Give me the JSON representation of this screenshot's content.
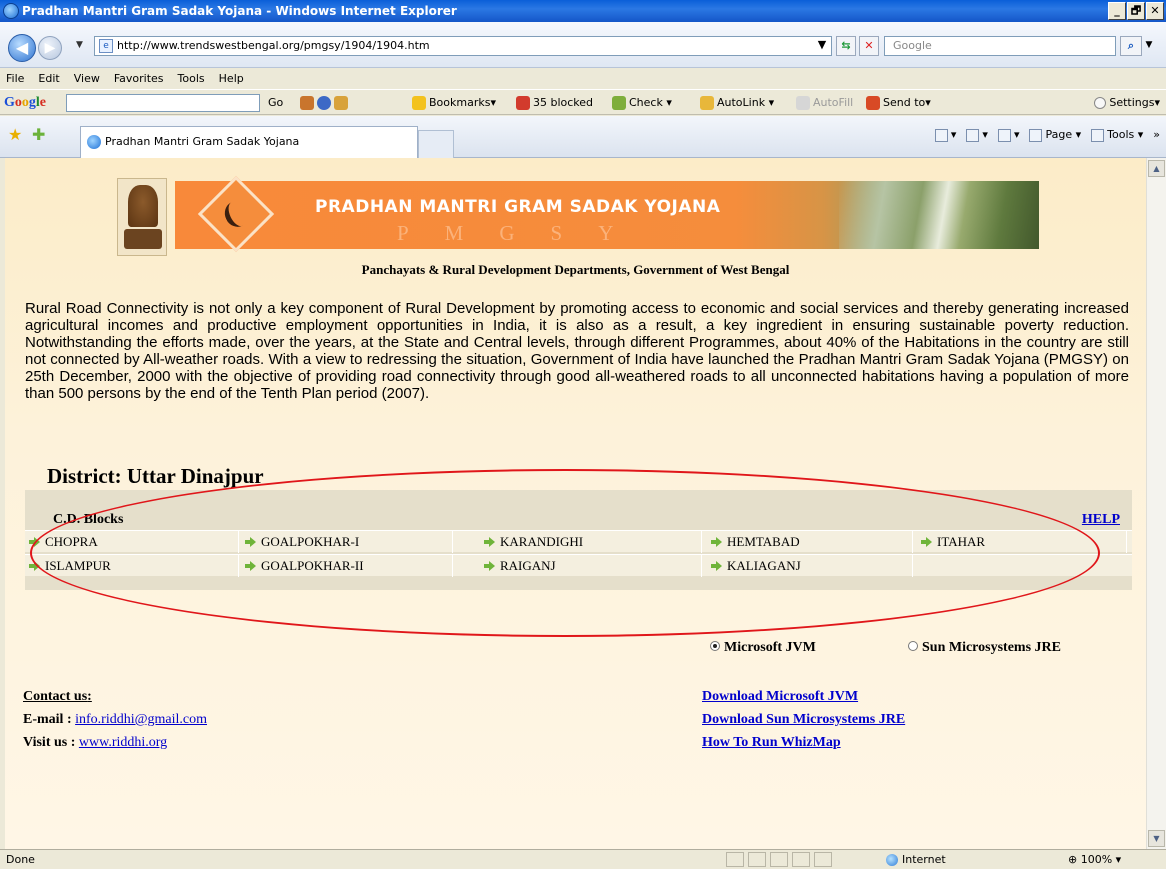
{
  "window": {
    "title": "Pradhan Mantri Gram Sadak Yojana - Windows Internet Explorer",
    "min": "_",
    "max": "🗗",
    "close": "✕"
  },
  "address": {
    "url": "http://www.trendswestbengal.org/pmgsy/1904/1904.htm",
    "search_placeholder": "Google"
  },
  "menu": [
    "File",
    "Edit",
    "View",
    "Favorites",
    "Tools",
    "Help"
  ],
  "google_toolbar": {
    "go": "Go",
    "bookmarks": "Bookmarks▾",
    "blocked": "35 blocked",
    "check": "Check ▾",
    "autolink": "AutoLink ▾",
    "autofill": "AutoFill",
    "send_to": "Send to▾",
    "settings": "Settings▾"
  },
  "tabs": {
    "active_label": "Pradhan Mantri Gram Sadak Yojana"
  },
  "command_bar": {
    "page": "Page ▾",
    "tools": "Tools ▾"
  },
  "banner": {
    "title": "PRADHAN MANTRI GRAM SADAK YOJANA",
    "subtitle": "PMGSY",
    "department": "Panchayats & Rural Development Departments, Government of West Bengal"
  },
  "intro": "Rural Road Connectivity is not only a key component of Rural Development by promoting access to economic and social services and thereby generating increased agricultural incomes and productive employment opportunities in India, it is also as a result, a key ingredient in ensuring sustainable poverty reduction. Notwithstanding the efforts made, over the years, at the State and Central levels, through different Programmes, about 40% of the Habitations in the country are still not connected by All-weather roads. With a view to redressing the situation, Government of India have launched the Pradhan Mantri Gram Sadak Yojana (PMGSY) on 25th December, 2000 with the objective of providing road connectivity through good all-weathered roads to all unconnected habitations having a population of more than 500 persons by the end of the Tenth Plan period (2007).",
  "district": "District: Uttar Dinajpur",
  "blocks": {
    "title": "C.D. Blocks",
    "help": "HELP",
    "row1": [
      "CHOPRA",
      "GOALPOKHAR-I",
      "KARANDIGHI",
      "HEMTABAD",
      "ITAHAR"
    ],
    "row2": [
      "ISLAMPUR",
      "GOALPOKHAR-II",
      "RAIGANJ",
      "KALIAGANJ"
    ]
  },
  "jvm": {
    "microsoft": "Microsoft JVM",
    "sun": "Sun Microsystems JRE",
    "selected": "microsoft"
  },
  "contact": {
    "label": "Contact us",
    "email_label": "E-mail : ",
    "email": "info.riddhi@gmail.com",
    "visit_label": "Visit us : ",
    "website": "www.riddhi.org"
  },
  "downloads": {
    "ms_jvm": "Download Microsoft JVM",
    "sun_jre": "Download Sun Microsystems JRE",
    "how_to": "How To Run WhizMap"
  },
  "status": {
    "text": "Done",
    "zone": "Internet",
    "zoom": "100%"
  },
  "colors": {
    "annotation_ellipse": "#e0161a",
    "link": "#0000cc",
    "banner_orange": "#f58d3c"
  }
}
